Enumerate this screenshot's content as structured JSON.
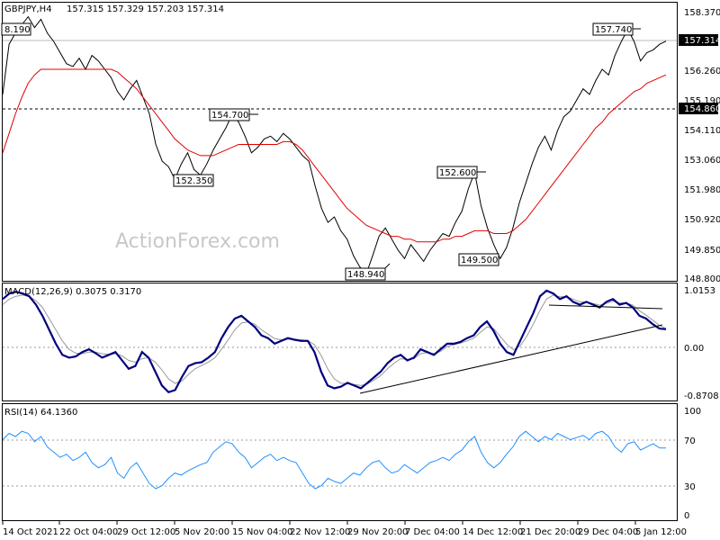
{
  "main": {
    "title": "GBPJPY,H4",
    "ohlc": "157.315 157.329 157.203 157.314",
    "watermark": "ActionForex.com",
    "yticks": [
      "158.370",
      "157.314",
      "156.260",
      "155.190",
      "154.860",
      "154.110",
      "153.060",
      "151.980",
      "150.920",
      "149.850",
      "148.800"
    ],
    "current_price": "157.314",
    "level_price": "154.860",
    "labels": [
      "8.190",
      "154.700",
      "152.350",
      "148.940",
      "152.600",
      "149.500",
      "157.740"
    ]
  },
  "macd": {
    "title": "MACD(12,26,9) 0.3075 0.3170",
    "yticks": [
      "1.0153",
      "0.00",
      "-0.8708"
    ]
  },
  "rsi": {
    "title": "RSI(14) 64.1360",
    "yticks": [
      "100",
      "70",
      "30",
      "0"
    ]
  },
  "xaxis": {
    "labels": [
      "14 Oct 2021",
      "22 Oct 04:00",
      "29 Oct 12:00",
      "5 Nov 20:00",
      "15 Nov 04:00",
      "22 Nov 12:00",
      "29 Nov 20:00",
      "7 Dec 04:00",
      "14 Dec 12:00",
      "21 Dec 20:00",
      "29 Dec 04:00",
      "5 Jan 12:00"
    ]
  },
  "chart_data": [
    {
      "type": "line",
      "title": "GBPJPY,H4",
      "ylim": [
        148.8,
        158.37
      ],
      "reference_levels": [
        157.314,
        154.86
      ],
      "series": [
        {
          "values": [
            155.4,
            157.2,
            157.6,
            157.9,
            158.19,
            157.8,
            158.1,
            157.6,
            157.3,
            156.9,
            156.5,
            156.4,
            156.7,
            156.3,
            156.8,
            156.6,
            156.3,
            156.0,
            155.5,
            155.2,
            155.6,
            155.9,
            155.3,
            154.7,
            153.6,
            153.0,
            152.8,
            152.35,
            152.9,
            153.3,
            152.7,
            152.5,
            152.9,
            153.4,
            153.8,
            154.2,
            154.7,
            154.4,
            153.9,
            153.3,
            153.5,
            153.8,
            153.9,
            153.7,
            154.0,
            153.8,
            153.5,
            153.2,
            153.0,
            152.1,
            151.3,
            150.8,
            151.0,
            150.5,
            150.2,
            149.6,
            149.2,
            148.94,
            149.6,
            150.3,
            150.6,
            150.2,
            149.8,
            149.5,
            150.0,
            149.7,
            149.4,
            149.8,
            150.1,
            150.4,
            150.3,
            150.8,
            151.2,
            152.0,
            152.6,
            151.4,
            150.6,
            150.0,
            149.5,
            149.9,
            150.6,
            151.5,
            152.2,
            152.9,
            153.5,
            153.9,
            153.4,
            154.1,
            154.6,
            154.8,
            155.2,
            155.6,
            155.4,
            155.9,
            156.3,
            156.1,
            156.8,
            157.3,
            157.74,
            157.3,
            156.6,
            156.9,
            157.0,
            157.2,
            157.314
          ]
        },
        {
          "values": [
            153.3,
            154.0,
            154.7,
            155.3,
            155.8,
            156.1,
            156.3,
            156.3,
            156.3,
            156.3,
            156.3,
            156.3,
            156.3,
            156.3,
            156.3,
            156.3,
            156.3,
            156.3,
            156.2,
            156.0,
            155.8,
            155.6,
            155.3,
            155.0,
            154.7,
            154.4,
            154.1,
            153.8,
            153.6,
            153.4,
            153.3,
            153.2,
            153.2,
            153.2,
            153.3,
            153.4,
            153.5,
            153.6,
            153.6,
            153.6,
            153.6,
            153.6,
            153.6,
            153.6,
            153.7,
            153.7,
            153.6,
            153.4,
            153.1,
            152.8,
            152.5,
            152.2,
            151.9,
            151.6,
            151.3,
            151.1,
            150.9,
            150.7,
            150.6,
            150.5,
            150.4,
            150.3,
            150.3,
            150.2,
            150.2,
            150.1,
            150.1,
            150.1,
            150.1,
            150.2,
            150.2,
            150.3,
            150.3,
            150.4,
            150.5,
            150.5,
            150.5,
            150.4,
            150.4,
            150.4,
            150.5,
            150.7,
            150.9,
            151.2,
            151.5,
            151.8,
            152.1,
            152.4,
            152.7,
            153.0,
            153.3,
            153.6,
            153.9,
            154.2,
            154.4,
            154.7,
            154.9,
            155.1,
            155.3,
            155.5,
            155.6,
            155.8,
            155.9,
            156.0,
            156.1
          ]
        }
      ]
    },
    {
      "type": "line",
      "title": "MACD(12,26,9) 0.3075 0.3170",
      "ylim": [
        -0.8708,
        1.0153
      ],
      "series": [
        {
          "values": [
            0.85,
            0.95,
            0.98,
            0.95,
            0.9,
            0.75,
            0.55,
            0.3,
            0.05,
            -0.15,
            -0.2,
            -0.18,
            -0.1,
            -0.05,
            -0.12,
            -0.2,
            -0.15,
            -0.1,
            -0.25,
            -0.4,
            -0.35,
            -0.1,
            -0.2,
            -0.45,
            -0.7,
            -0.82,
            -0.78,
            -0.55,
            -0.35,
            -0.3,
            -0.28,
            -0.2,
            -0.1,
            0.15,
            0.35,
            0.5,
            0.55,
            0.45,
            0.35,
            0.2,
            0.15,
            0.05,
            0.1,
            0.15,
            0.12,
            0.1,
            0.1,
            -0.1,
            -0.45,
            -0.7,
            -0.75,
            -0.72,
            -0.65,
            -0.7,
            -0.75,
            -0.65,
            -0.55,
            -0.45,
            -0.3,
            -0.2,
            -0.15,
            -0.25,
            -0.2,
            -0.05,
            -0.1,
            -0.15,
            -0.05,
            0.05,
            0.05,
            0.08,
            0.15,
            0.2,
            0.35,
            0.45,
            0.28,
            0.05,
            -0.1,
            -0.15,
            0.1,
            0.35,
            0.6,
            0.9,
            1.0,
            0.95,
            0.85,
            0.9,
            0.8,
            0.75,
            0.8,
            0.75,
            0.7,
            0.8,
            0.85,
            0.75,
            0.78,
            0.7,
            0.55,
            0.5,
            0.4,
            0.32,
            0.31
          ]
        },
        {
          "values": [
            0.75,
            0.85,
            0.9,
            0.92,
            0.9,
            0.82,
            0.7,
            0.5,
            0.3,
            0.1,
            -0.05,
            -0.12,
            -0.13,
            -0.1,
            -0.1,
            -0.13,
            -0.14,
            -0.13,
            -0.17,
            -0.25,
            -0.28,
            -0.22,
            -0.2,
            -0.28,
            -0.42,
            -0.58,
            -0.66,
            -0.62,
            -0.5,
            -0.4,
            -0.34,
            -0.28,
            -0.2,
            -0.05,
            0.12,
            0.3,
            0.42,
            0.44,
            0.4,
            0.3,
            0.22,
            0.14,
            0.12,
            0.13,
            0.13,
            0.12,
            0.11,
            0.03,
            -0.16,
            -0.4,
            -0.58,
            -0.66,
            -0.66,
            -0.68,
            -0.7,
            -0.67,
            -0.6,
            -0.52,
            -0.4,
            -0.3,
            -0.22,
            -0.23,
            -0.22,
            -0.13,
            -0.11,
            -0.13,
            -0.09,
            0.0,
            0.03,
            0.06,
            0.1,
            0.15,
            0.25,
            0.35,
            0.32,
            0.18,
            0.04,
            -0.06,
            0.01,
            0.18,
            0.4,
            0.65,
            0.85,
            0.92,
            0.89,
            0.89,
            0.85,
            0.8,
            0.8,
            0.77,
            0.74,
            0.77,
            0.81,
            0.78,
            0.78,
            0.74,
            0.64,
            0.56,
            0.47,
            0.38,
            0.32
          ]
        }
      ]
    },
    {
      "type": "line",
      "title": "RSI(14) 64.1360",
      "ylim": [
        0,
        100
      ],
      "series": [
        {
          "values": [
            72,
            78,
            75,
            80,
            78,
            70,
            75,
            65,
            60,
            55,
            58,
            52,
            55,
            60,
            50,
            45,
            48,
            55,
            40,
            35,
            45,
            50,
            40,
            30,
            25,
            28,
            35,
            40,
            38,
            42,
            45,
            48,
            50,
            60,
            65,
            70,
            68,
            60,
            55,
            45,
            50,
            55,
            58,
            52,
            55,
            52,
            50,
            40,
            30,
            25,
            28,
            35,
            32,
            30,
            35,
            40,
            38,
            45,
            50,
            52,
            45,
            40,
            42,
            48,
            44,
            40,
            45,
            50,
            52,
            55,
            52,
            58,
            62,
            70,
            75,
            60,
            50,
            45,
            50,
            58,
            65,
            75,
            80,
            75,
            70,
            75,
            72,
            78,
            75,
            72,
            74,
            76,
            72,
            78,
            80,
            75,
            65,
            60,
            68,
            70,
            62,
            65,
            68,
            64,
            64
          ]
        }
      ]
    }
  ]
}
